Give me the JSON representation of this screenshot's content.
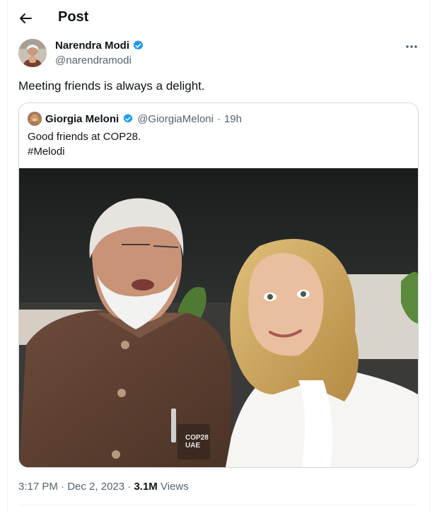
{
  "header": {
    "title": "Post",
    "back_icon": "arrow-left-icon"
  },
  "post": {
    "author_name": "Narendra Modi",
    "handle": "@narendramodi",
    "verified_icon": "verified-badge-icon",
    "more_icon": "more-horizontal-icon",
    "text": "Meeting friends is always a delight."
  },
  "quote": {
    "author_name": "Giorgia Meloni",
    "handle": "@GiorgiaMeloni",
    "separator": "·",
    "time": "19h",
    "line1": "Good friends at COP28.",
    "line2": "#Melodi",
    "media_icon": "selfie-photo-image",
    "badge_text": "COP28 UAE"
  },
  "meta": {
    "time": "3:17 PM",
    "separator": "·",
    "date": "Dec 2, 2023",
    "views_count": "3.1M",
    "views_label": "Views"
  },
  "colors": {
    "text": "#0f1419",
    "muted": "#536471",
    "verified": "#1d9bf0",
    "border": "#cfd9de"
  }
}
